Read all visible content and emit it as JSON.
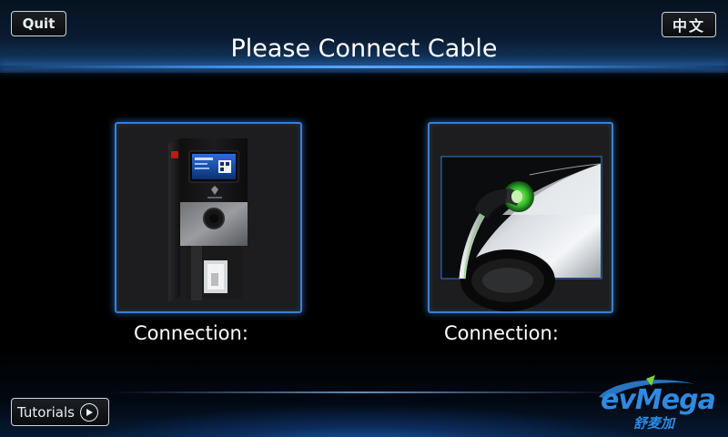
{
  "header": {
    "quit_label": "Quit",
    "language_label": "中文",
    "title": "Please Connect Cable"
  },
  "panels": {
    "charger": {
      "label": "Connection:"
    },
    "vehicle": {
      "label": "Connection:"
    }
  },
  "footer": {
    "tutorials_label": "Tutorials",
    "brand_logo_text": "evMega",
    "brand_logo_subtext": "舒麦加"
  },
  "colors": {
    "accent": "#3a7fd4",
    "brand": "#2f8ae0",
    "text": "#ffffff"
  },
  "icons": {
    "play": "play-circle-icon"
  }
}
